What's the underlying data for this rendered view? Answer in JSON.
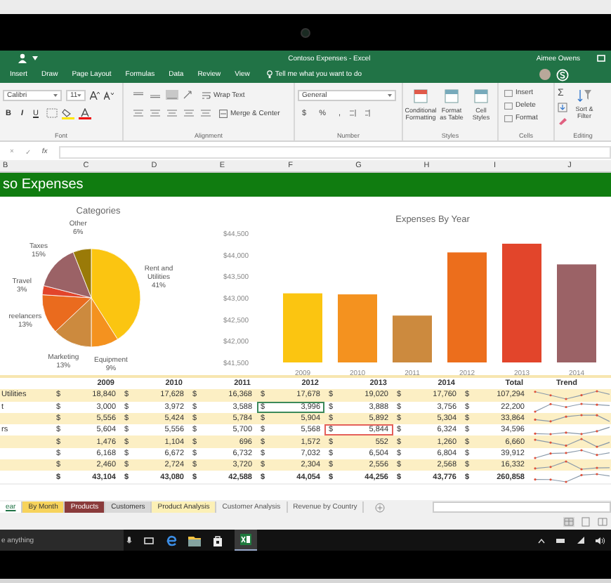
{
  "title_bar": {
    "title": "Contoso Expenses - Excel",
    "user": "Aimee Owens"
  },
  "ribbon_tabs": [
    "Insert",
    "Draw",
    "Page Layout",
    "Formulas",
    "Data",
    "Review",
    "View"
  ],
  "tell_me": "Tell me what you want to do",
  "ribbon": {
    "font_name": "Calibri",
    "font_size": "11",
    "font_styles": [
      "B",
      "I",
      "U"
    ],
    "wrap_text": "Wrap Text",
    "merge": "Merge & Center",
    "number_format": "General",
    "number_buttons": [
      "$",
      "%",
      ","
    ],
    "styles": [
      "Conditional Formatting",
      "Format as Table",
      "Cell Styles"
    ],
    "cells": [
      "Insert",
      "Delete",
      "Format"
    ],
    "sum": "Σ",
    "sort": "Sort & Filter",
    "groups": [
      "Font",
      "Alignment",
      "Number",
      "Styles",
      "Cells",
      "Editing"
    ]
  },
  "formula_bar": {
    "buttons": [
      "×",
      "✓",
      "fx"
    ]
  },
  "column_headers": [
    "B",
    "C",
    "D",
    "E",
    "F",
    "G",
    "H",
    "I",
    "J"
  ],
  "sheet_title": "so Expenses",
  "pie_chart": {
    "chart_data": {
      "type": "pie",
      "title": "Categories",
      "categories": [
        "Rent and Utilities",
        "Equipment",
        "Marketing",
        "reelancers",
        "Travel",
        "Taxes",
        "Other"
      ],
      "values": [
        41,
        9,
        13,
        13,
        3,
        15,
        6
      ],
      "colors": [
        "#fbc511",
        "#f4921f",
        "#cc8a3e",
        "#ea6b1e",
        "#e2452b",
        "#9b6266",
        "#9a7a08"
      ],
      "value_labels": [
        "41%",
        "9%",
        "13%",
        "13%",
        "3%",
        "15%",
        "6%"
      ]
    }
  },
  "bar_chart": {
    "chart_data": {
      "type": "bar",
      "title": "Expenses By Year",
      "categories": [
        "2009",
        "2010",
        "2011",
        "2012",
        "2013",
        "2014"
      ],
      "values": [
        43104,
        43080,
        42588,
        44054,
        44256,
        43776
      ],
      "colors": [
        "#fbc511",
        "#f4921f",
        "#cc8a3e",
        "#ec6e1c",
        "#e2452b",
        "#9b6266"
      ],
      "ylim": [
        41500,
        44500
      ],
      "yticks": [
        {
          "value": 41500,
          "label": "$41,500"
        },
        {
          "value": 42000,
          "label": "$42,000"
        },
        {
          "value": 42500,
          "label": "$42,500"
        },
        {
          "value": 43000,
          "label": "$43,000"
        },
        {
          "value": 43500,
          "label": "$43,500"
        },
        {
          "value": 44000,
          "label": "$44,000"
        },
        {
          "value": 44500,
          "label": "$44,500"
        }
      ]
    }
  },
  "table": {
    "columns": [
      "2009",
      "2010",
      "2011",
      "2012",
      "2013",
      "2014",
      "Total",
      "Trend"
    ],
    "rows": [
      {
        "kind": "data",
        "label": "Utilities",
        "cells": [
          {
            "cur": "$",
            "value": "18,840",
            "selected": false,
            "flagged": false
          },
          {
            "cur": "$",
            "value": "17,628",
            "selected": false,
            "flagged": false
          },
          {
            "cur": "$",
            "value": "16,368",
            "selected": false,
            "flagged": false
          },
          {
            "cur": "$",
            "value": "17,678",
            "selected": false,
            "flagged": false
          },
          {
            "cur": "$",
            "value": "19,020",
            "selected": false,
            "flagged": false
          },
          {
            "cur": "$",
            "value": "17,760",
            "selected": false,
            "flagged": false
          },
          {
            "cur": "$",
            "value": "107,294",
            "selected": false,
            "flagged": false
          }
        ]
      },
      {
        "kind": "data",
        "label": "t",
        "cells": [
          {
            "cur": "$",
            "value": "3,000",
            "selected": false,
            "flagged": false
          },
          {
            "cur": "$",
            "value": "3,972",
            "selected": false,
            "flagged": false
          },
          {
            "cur": "$",
            "value": "3,588",
            "selected": false,
            "flagged": false
          },
          {
            "cur": "$",
            "value": "3,996",
            "selected": true,
            "flagged": false
          },
          {
            "cur": "$",
            "value": "3,888",
            "selected": false,
            "flagged": false
          },
          {
            "cur": "$",
            "value": "3,756",
            "selected": false,
            "flagged": false
          },
          {
            "cur": "$",
            "value": "22,200",
            "selected": false,
            "flagged": false
          }
        ]
      },
      {
        "kind": "data",
        "cells": [
          {
            "cur": "$",
            "value": "5,556",
            "selected": false,
            "flagged": false
          },
          {
            "cur": "$",
            "value": "5,424",
            "selected": false,
            "flagged": false
          },
          {
            "cur": "$",
            "value": "5,784",
            "selected": false,
            "flagged": false
          },
          {
            "cur": "$",
            "value": "5,904",
            "selected": false,
            "flagged": false
          },
          {
            "cur": "$",
            "value": "5,892",
            "selected": false,
            "flagged": false
          },
          {
            "cur": "$",
            "value": "5,304",
            "selected": false,
            "flagged": false
          },
          {
            "cur": "$",
            "value": "33,864",
            "selected": false,
            "flagged": false
          }
        ]
      },
      {
        "kind": "data",
        "label": "rs",
        "cells": [
          {
            "cur": "$",
            "value": "5,604",
            "selected": false,
            "flagged": false
          },
          {
            "cur": "$",
            "value": "5,556",
            "selected": false,
            "flagged": false
          },
          {
            "cur": "$",
            "value": "5,700",
            "selected": false,
            "flagged": false
          },
          {
            "cur": "$",
            "value": "5,568",
            "selected": false,
            "flagged": false
          },
          {
            "cur": "$",
            "value": "5,844",
            "selected": false,
            "flagged": true
          },
          {
            "cur": "$",
            "value": "6,324",
            "selected": false,
            "flagged": false
          },
          {
            "cur": "$",
            "value": "34,596",
            "selected": false,
            "flagged": false
          }
        ]
      },
      {
        "kind": "data",
        "cells": [
          {
            "cur": "$",
            "value": "1,476",
            "selected": false,
            "flagged": false
          },
          {
            "cur": "$",
            "value": "1,104",
            "selected": false,
            "flagged": false
          },
          {
            "cur": "$",
            "value": "696",
            "selected": false,
            "flagged": false
          },
          {
            "cur": "$",
            "value": "1,572",
            "selected": false,
            "flagged": false
          },
          {
            "cur": "$",
            "value": "552",
            "selected": false,
            "flagged": false
          },
          {
            "cur": "$",
            "value": "1,260",
            "selected": false,
            "flagged": false
          },
          {
            "cur": "$",
            "value": "6,660",
            "selected": false,
            "flagged": false
          }
        ]
      },
      {
        "kind": "data",
        "cells": [
          {
            "cur": "$",
            "value": "6,168",
            "selected": false,
            "flagged": false
          },
          {
            "cur": "$",
            "value": "6,672",
            "selected": false,
            "flagged": false
          },
          {
            "cur": "$",
            "value": "6,732",
            "selected": false,
            "flagged": false
          },
          {
            "cur": "$",
            "value": "7,032",
            "selected": false,
            "flagged": false
          },
          {
            "cur": "$",
            "value": "6,504",
            "selected": false,
            "flagged": false
          },
          {
            "cur": "$",
            "value": "6,804",
            "selected": false,
            "flagged": false
          },
          {
            "cur": "$",
            "value": "39,912",
            "selected": false,
            "flagged": false
          }
        ]
      },
      {
        "kind": "data",
        "cells": [
          {
            "cur": "$",
            "value": "2,460",
            "selected": false,
            "flagged": false
          },
          {
            "cur": "$",
            "value": "2,724",
            "selected": false,
            "flagged": false
          },
          {
            "cur": "$",
            "value": "3,720",
            "selected": false,
            "flagged": false
          },
          {
            "cur": "$",
            "value": "2,304",
            "selected": false,
            "flagged": false
          },
          {
            "cur": "$",
            "value": "2,556",
            "selected": false,
            "flagged": false
          },
          {
            "cur": "$",
            "value": "2,568",
            "selected": false,
            "flagged": false
          },
          {
            "cur": "$",
            "value": "16,332",
            "selected": false,
            "flagged": false
          }
        ]
      },
      {
        "kind": "total",
        "cells": [
          {
            "cur": "$",
            "value": "43,104",
            "selected": false,
            "flagged": false
          },
          {
            "cur": "$",
            "value": "43,080",
            "selected": false,
            "flagged": false
          },
          {
            "cur": "$",
            "value": "42,588",
            "selected": false,
            "flagged": false
          },
          {
            "cur": "$",
            "value": "44,054",
            "selected": false,
            "flagged": false
          },
          {
            "cur": "$",
            "value": "44,256",
            "selected": false,
            "flagged": false
          },
          {
            "cur": "$",
            "value": "43,776",
            "selected": false,
            "flagged": false
          },
          {
            "cur": "$",
            "value": "260,858",
            "selected": false,
            "flagged": false
          }
        ]
      }
    ]
  },
  "sheet_tabs": [
    {
      "label": "ear",
      "selected": true
    },
    {
      "label": "By Month",
      "selected": false,
      "color": "#f7d35c"
    },
    {
      "label": "Products",
      "selected": false,
      "color": "#8a3b3b"
    },
    {
      "label": "Customers",
      "selected": false,
      "color": "#d9d9d9"
    },
    {
      "label": "Product Analysis",
      "selected": false,
      "color": "#fcf0b6"
    },
    {
      "label": "Customer Analysis",
      "selected": false
    },
    {
      "label": "Revenue by Country",
      "selected": false
    }
  ],
  "taskbar": {
    "search": {
      "placeholder": "e anything"
    }
  }
}
